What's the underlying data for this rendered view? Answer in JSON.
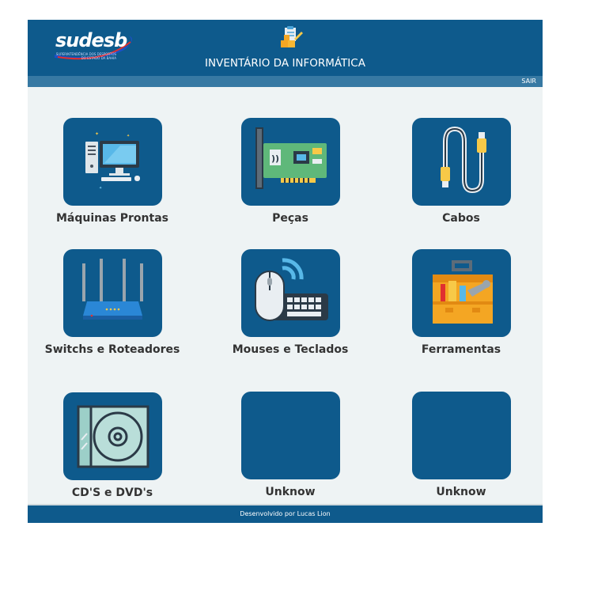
{
  "header": {
    "logo_text": "sudesb",
    "logo_subtitle": "SUPERINTENDÊNCIA DOS DESPORTOS DO ESTADO DA BAHIA",
    "title": "INVENTÁRIO DA INFORMÁTICA",
    "logout_label": "SAIR"
  },
  "categories": [
    {
      "label": "Máquinas Prontas",
      "icon": "computer-icon"
    },
    {
      "label": "Peças",
      "icon": "network-card-icon"
    },
    {
      "label": "Cabos",
      "icon": "cable-icon"
    },
    {
      "label": "Switchs e Roteadores",
      "icon": "router-icon"
    },
    {
      "label": "Mouses e Teclados",
      "icon": "mouse-keyboard-icon"
    },
    {
      "label": "Ferramentas",
      "icon": "toolbox-icon"
    },
    {
      "label": "CD'S e DVD's",
      "icon": "cd-icon"
    },
    {
      "label": "Unknow",
      "icon": ""
    },
    {
      "label": "Unknow",
      "icon": ""
    }
  ],
  "footer": {
    "credit": "Desenvolvido por Lucas Lion"
  },
  "colors": {
    "primary": "#0e5a8c",
    "subbar": "#3779a3",
    "background": "#eef3f4"
  }
}
